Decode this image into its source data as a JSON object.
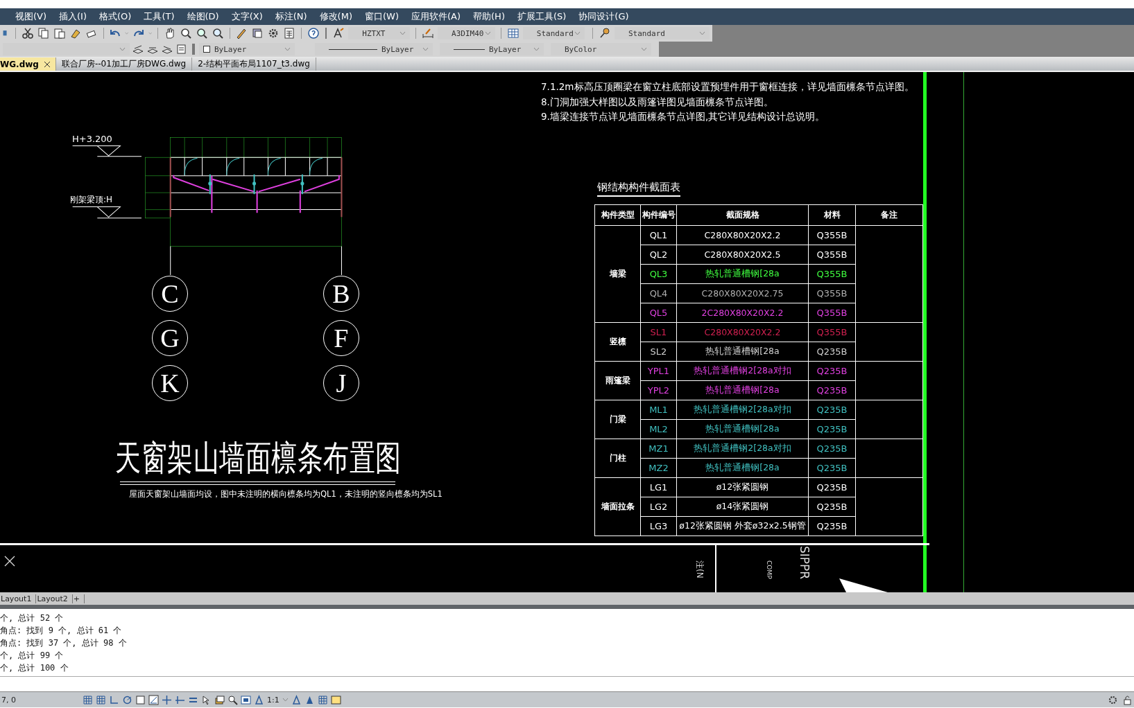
{
  "menu": [
    {
      "label": "视图(V)"
    },
    {
      "label": "插入(I)"
    },
    {
      "label": "格式(O)"
    },
    {
      "label": "工具(T)"
    },
    {
      "label": "绘图(D)"
    },
    {
      "label": "文字(X)"
    },
    {
      "label": "标注(N)"
    },
    {
      "label": "修改(M)"
    },
    {
      "label": "窗口(W)"
    },
    {
      "label": "应用软件(A)"
    },
    {
      "label": "帮助(H)"
    },
    {
      "label": "扩展工具(S)"
    },
    {
      "label": "协同设计(G)"
    }
  ],
  "toolbar": {
    "text_style": "HZTXT",
    "dim_style": "A3DIM40",
    "table_style": "Standard",
    "multileader_style": "Standard"
  },
  "properties_bar": {
    "color_setting": "ByLayer",
    "linetype": "ByLayer",
    "lineweight": "ByLayer",
    "plot_style": "ByColor"
  },
  "document_tabs": [
    {
      "label": "WG.dwg",
      "selected": true
    },
    {
      "label": "联合厂房--01加工厂房DWG.dwg",
      "selected": false
    },
    {
      "label": "2-结构平面布局1107_t3.dwg",
      "selected": false
    }
  ],
  "drawing": {
    "notes": [
      "7.1.2m标高压顶圈梁在窗立柱底部设置预埋件用于窗框连接，详见墙面檩条节点详图。",
      "8.门洞加强大样图以及雨篷详图见墙面檩条节点详图。",
      "9.墙梁连接节点详见墙面檩条节点详图,其它详见结构设计总说明。"
    ],
    "level_labels": [
      "H+3.200",
      "刚架梁顶:H"
    ],
    "axis_bubbles": [
      "C",
      "B",
      "G",
      "F",
      "K",
      "J"
    ],
    "title": "天窗架山墙面檩条布置图",
    "subtitle": "屋面天窗架山墙面均设，图中未注明的横向檩条均为QL1，未注明的竖向檩条均为SL1",
    "table": {
      "title": "钢结构构件截面表",
      "columns": [
        "构件类型",
        "构件编号",
        "截面规格",
        "材料",
        "备注"
      ],
      "groups": [
        {
          "type": "墙梁",
          "rows": [
            {
              "code": "QL1",
              "section": "C280X80X20X2.2",
              "material": "Q355B",
              "color": "#ffffff"
            },
            {
              "code": "QL2",
              "section": "C280X80X20X2.5",
              "material": "Q355B",
              "color": "#ffffff"
            },
            {
              "code": "QL3",
              "section": "热轧普通槽钢[28a",
              "material": "Q355B",
              "color": "#40ff40"
            },
            {
              "code": "QL4",
              "section": "C280X80X20X2.75",
              "material": "Q355B",
              "color": "#b0b0b0"
            },
            {
              "code": "QL5",
              "section": "2C280X80X20X2.2",
              "material": "Q355B",
              "color": "#e040e0"
            }
          ]
        },
        {
          "type": "竖檩",
          "rows": [
            {
              "code": "SL1",
              "section": "C280X80X20X2.2",
              "material": "Q355B",
              "color": "#d02050"
            },
            {
              "code": "SL2",
              "section": "热轧普通槽钢[28a",
              "material": "Q235B",
              "color": "#d0d0d0"
            }
          ]
        },
        {
          "type": "雨篷梁",
          "rows": [
            {
              "code": "YPL1",
              "section": "热轧普通槽钢2[28a对扣",
              "material": "Q235B",
              "color": "#e040e0"
            },
            {
              "code": "YPL2",
              "section": "热轧普通槽钢[28a",
              "material": "Q235B",
              "color": "#e040e0"
            }
          ]
        },
        {
          "type": "门梁",
          "rows": [
            {
              "code": "ML1",
              "section": "热轧普通槽钢2[28a对扣",
              "material": "Q235B",
              "color": "#40c0c0"
            },
            {
              "code": "ML2",
              "section": "热轧普通槽钢[28a",
              "material": "Q235B",
              "color": "#40c0c0"
            }
          ]
        },
        {
          "type": "门柱",
          "rows": [
            {
              "code": "MZ1",
              "section": "热轧普通槽钢2[28a对扣",
              "material": "Q235B",
              "color": "#40c0c0"
            },
            {
              "code": "MZ2",
              "section": "热轧普通槽钢[28a",
              "material": "Q235B",
              "color": "#40c0c0"
            }
          ]
        },
        {
          "type": "墙面拉条",
          "rows": [
            {
              "code": "LG1",
              "section": "ø12张紧圆钢",
              "material": "Q235B",
              "color": "#ffffff"
            },
            {
              "code": "LG2",
              "section": "ø14张紧圆钢",
              "material": "Q235B",
              "color": "#ffffff"
            },
            {
              "code": "LG3",
              "section": "ø12张紧圆钢 外套ø32x2.5钢管",
              "material": "Q235B",
              "color": "#ffffff"
            }
          ]
        }
      ]
    },
    "title_block": [
      "注(N",
      "COMP",
      "SIPPR"
    ]
  },
  "layout_tabs": [
    {
      "label": "Layout1",
      "selected": false
    },
    {
      "label": "Layout2",
      "selected": false
    },
    {
      "label": "+",
      "selected": false
    }
  ],
  "command_history": [
    "个, 总计 52 个",
    "角点: 找到 9 个, 总计 61 个",
    "角点: 找到 37 个, 总计 98 个",
    "个, 总计 99 个",
    "个, 总计 100 个"
  ],
  "status_bar": {
    "coordinates": "7, 0",
    "scale": "1:1"
  }
}
